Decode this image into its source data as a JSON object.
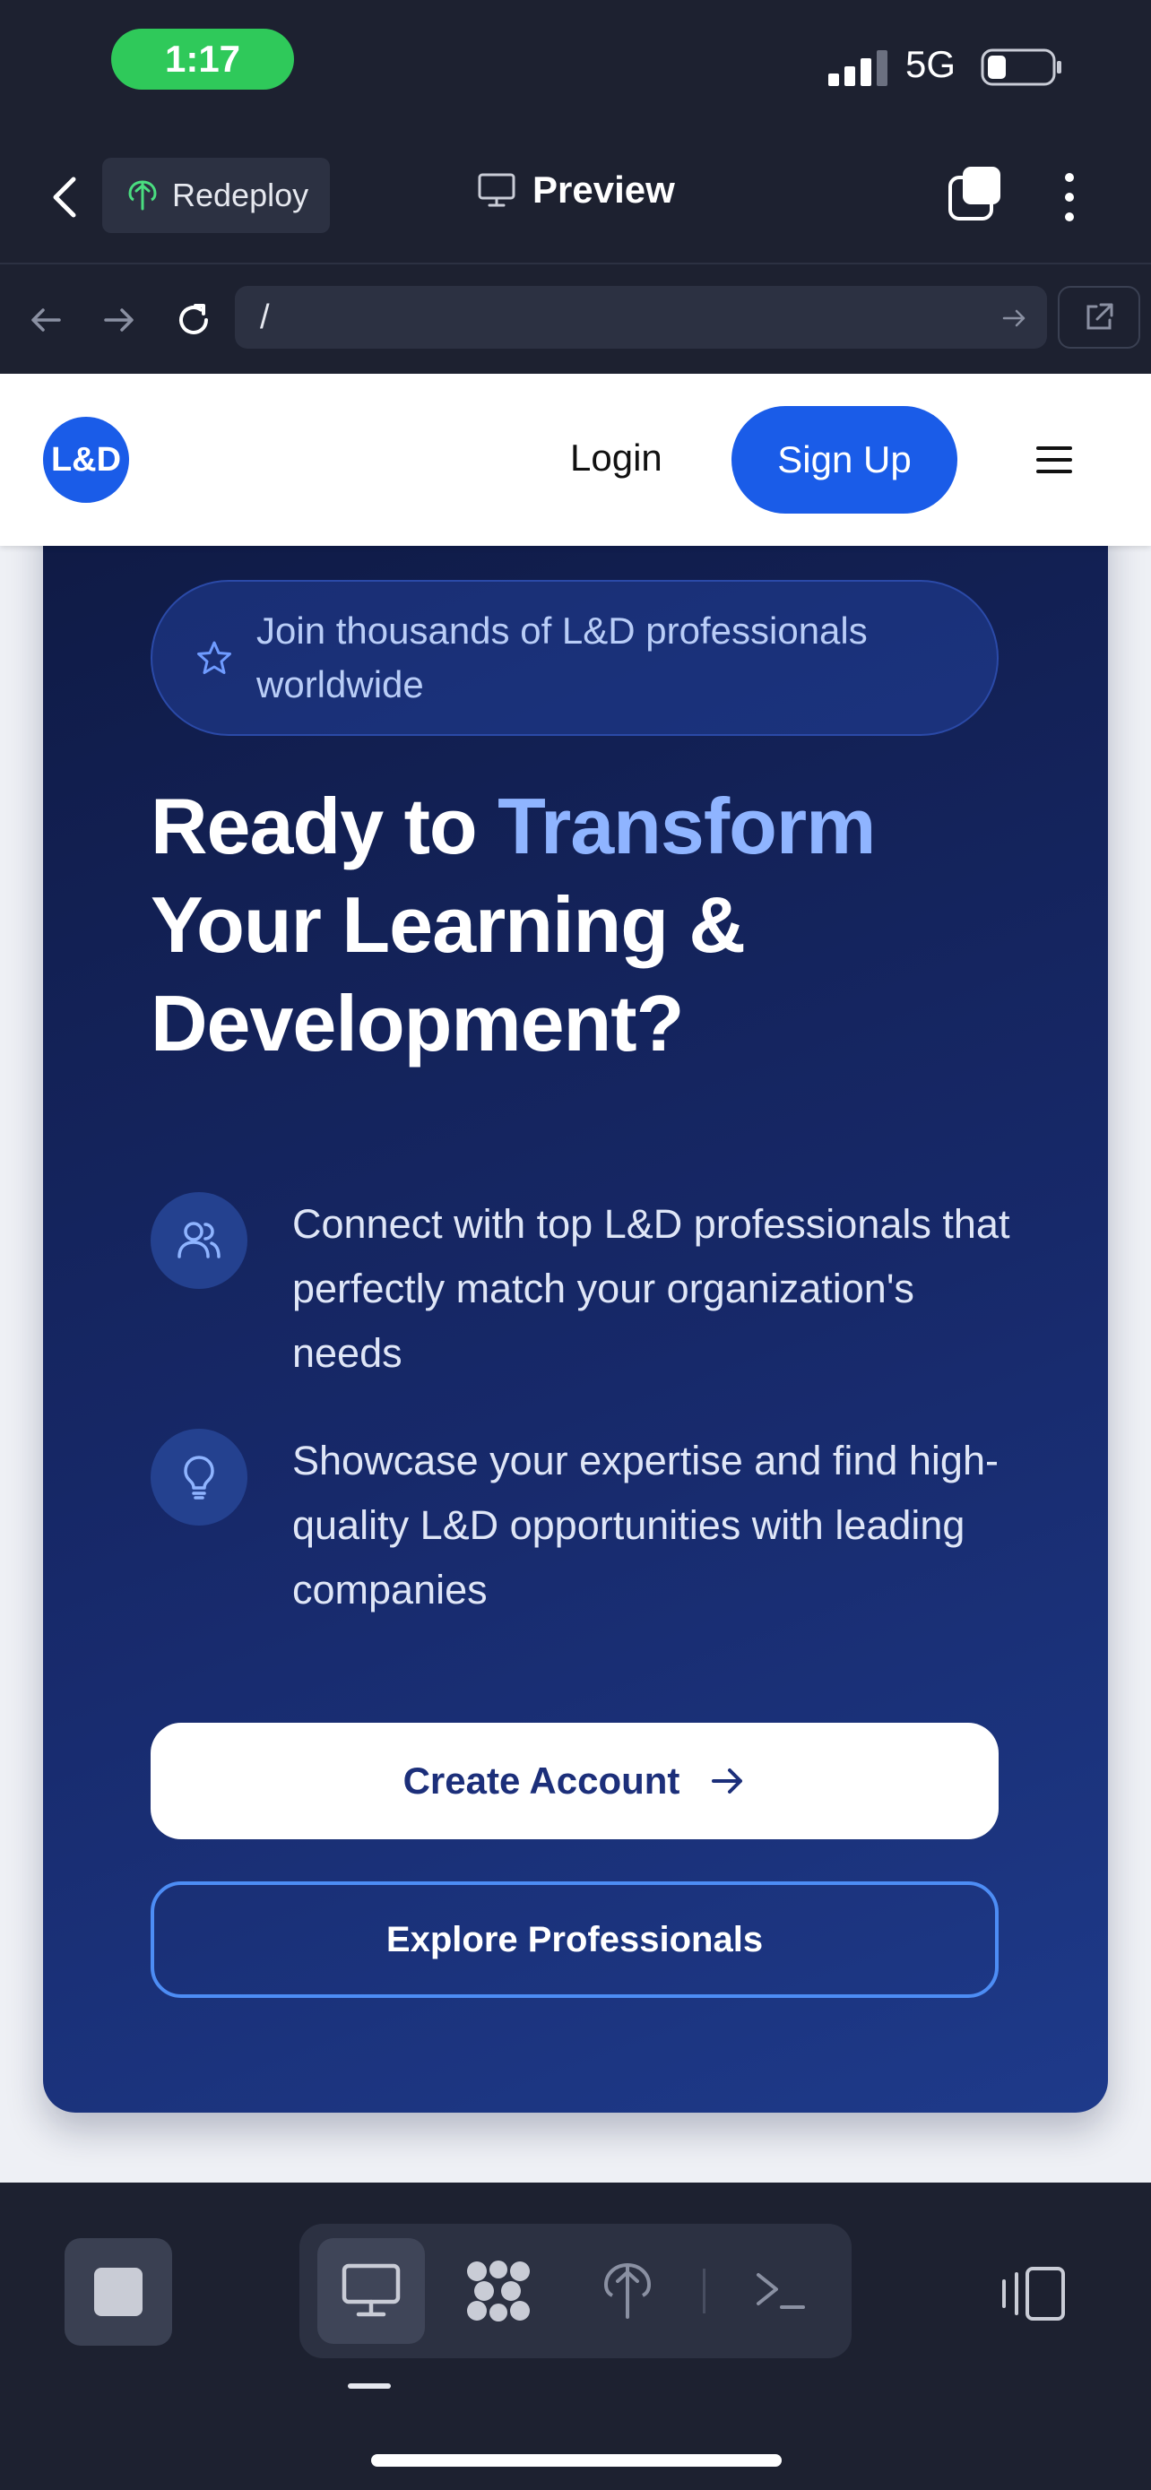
{
  "status_bar": {
    "time": "1:17",
    "network": "5G"
  },
  "app_toolbar": {
    "redeploy_label": "Redeploy",
    "preview_label": "Preview"
  },
  "browser": {
    "url": "/"
  },
  "site_nav": {
    "logo_text": "L&D",
    "login_label": "Login",
    "signup_label": "Sign Up"
  },
  "cta": {
    "badge_text": "Join thousands of L&D professionals worldwide",
    "headline_before": "Ready to ",
    "headline_accent": "Transform",
    "headline_after": " Your Learning & Development?",
    "features": [
      {
        "icon": "users-icon",
        "text": "Connect with top L&D professionals that perfectly match your organization's needs"
      },
      {
        "icon": "lightbulb-icon",
        "text": "Showcase your expertise and find high-quality L&D opportunities with leading companies"
      }
    ],
    "create_account_label": "Create Account",
    "explore_label": "Explore Professionals"
  },
  "colors": {
    "brand_blue": "#1a5ce8",
    "accent_text": "#8fb4ff",
    "card_dark": "#0f1a44",
    "status_green": "#2fc95a"
  }
}
